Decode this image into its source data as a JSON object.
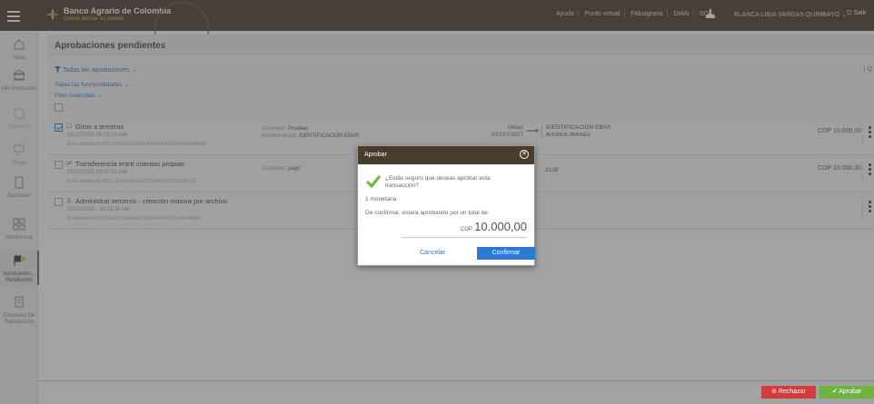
{
  "header": {
    "brand": "Banco Agrario de Colombia",
    "tagline": "Crecer pensar es posible",
    "links": [
      "Ayuda",
      "Punto virtual",
      "Fiduagraria",
      "DIAN",
      "SOI"
    ],
    "user_name": "BLANCA LIBIA VARGAS QUIMBAYO",
    "logout_label": "Salir"
  },
  "sidebar": {
    "items": [
      {
        "label": "Inicio",
        "icon": "home-icon"
      },
      {
        "label": "Mis Productos",
        "icon": "bank-icon"
      },
      {
        "label": "Transferir",
        "icon": "transfer-icon"
      },
      {
        "label": "Pagar",
        "icon": "pay-icon"
      },
      {
        "label": "Gestionar",
        "icon": "manage-icon"
      },
      {
        "label": "Administrar",
        "icon": "grid-icon"
      },
      {
        "label": "Aprobacion... Pendientes",
        "icon": "flag-icon"
      },
      {
        "label": "Encuesta De Satisfacción",
        "icon": "survey-icon"
      }
    ]
  },
  "page": {
    "title": "Aprobaciones pendientes",
    "filter_all": "Todas las aprobaciones",
    "filter_functionalities": "Todas las funcionalidades",
    "filter_advanced": "Filtro Avanzado"
  },
  "rows": [
    {
      "title": "Giros a terceros",
      "date": "22/12/2025 09:16:18 AM",
      "meta": "Id de solicitud:41547 | CIFIN CALIDAD IDENTIFICACION PRUEBAS",
      "concept_label": "Concepto:",
      "concept": "Pruebas",
      "holder_label": "Nombre titular:",
      "holder": "IDENTIFICACION EBAS",
      "acct_alias": "(Alias)",
      "acct_number": "XXXXX-0377",
      "dest_title": "IDENTIFICACION EBAS",
      "dest_sub": "AVENIDA JIMENEZ",
      "amount": "COP 10.000,00"
    },
    {
      "title": "Transferencia entre cuentas propias",
      "date": "15/12/2025 10:47:32 AM",
      "meta": "Id de solicitud:41550 | CESAR AUGUSTO CARAVITO BENITEZ",
      "concept_label": "Concepto:",
      "concept": "pago",
      "dest_title": "2139",
      "amount": "COP 10.000,00"
    },
    {
      "title": "Administrar terceros - creación masiva por archivo",
      "date": "12/12/2025 - 11:21:26 AM",
      "meta": "ID solicitud:41523 | CIFIN CALIDAD IDENTIFICACION PRUEBAS"
    }
  ],
  "modal": {
    "title": "Aprobar",
    "question": "¿Estás seguro que deseas aprobar esta transacción?",
    "count": "1 monetaria",
    "confirm_text": "De confirmar, estará aprobando por un total de:",
    "currency": "COP",
    "total": "10.000,00",
    "cancel_label": "Cancelar",
    "confirm_label": "Confirmar"
  },
  "footer": {
    "reject_label": "Rechazar",
    "approve_label": "Aprobar"
  },
  "colors": {
    "header_bg": "#4a3b2b",
    "accent_blue": "#2b7bd6",
    "accent_green": "#8ac43f",
    "reject_red": "#d33c3c",
    "approve_green": "#6fb43f"
  }
}
